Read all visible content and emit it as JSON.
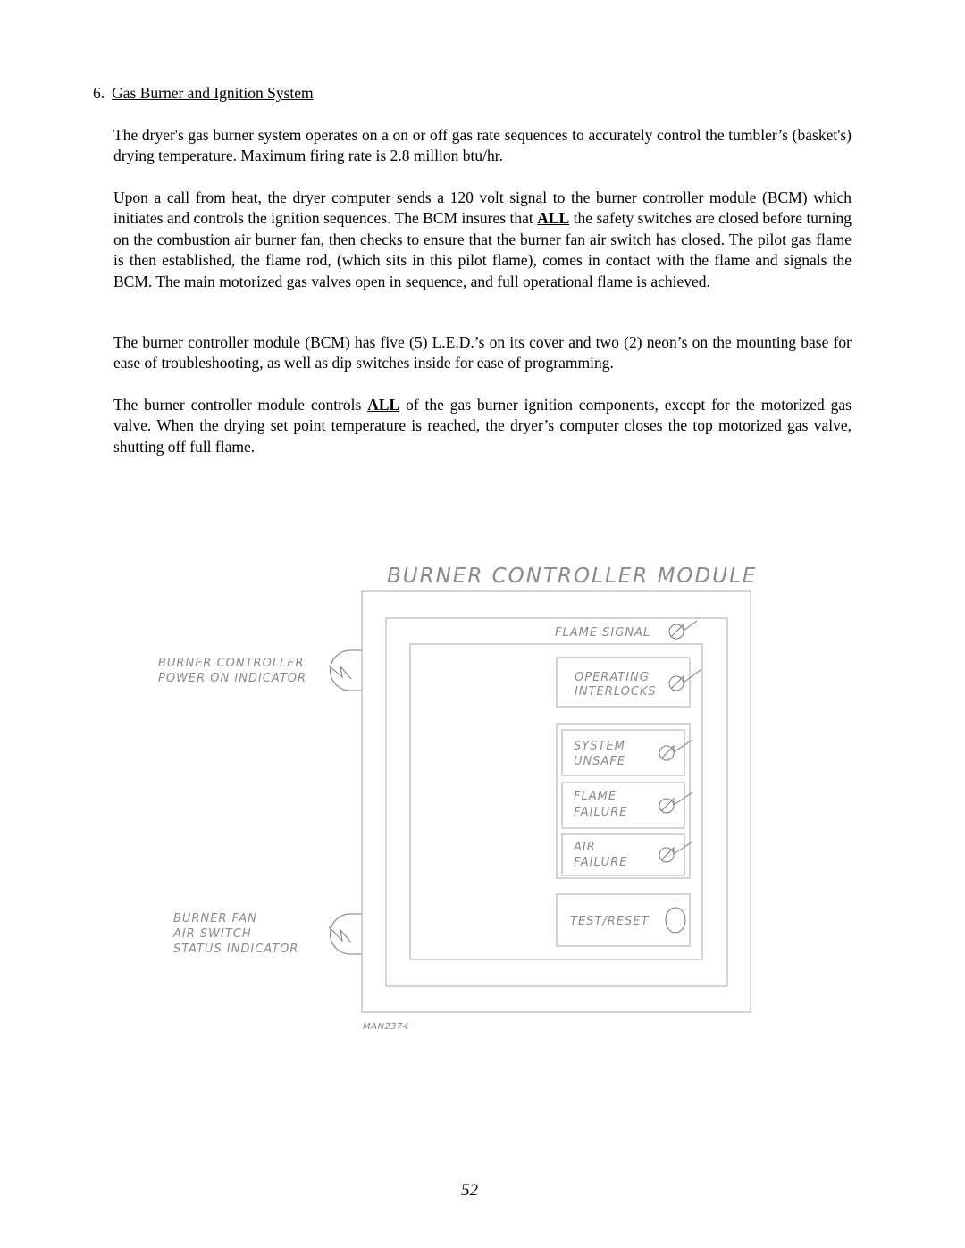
{
  "section": {
    "number": "6.",
    "title": "Gas Burner and Ignition System"
  },
  "paragraphs": {
    "p1": "The dryer's gas burner system operates on a on or off gas rate sequences to accurately control the tumbler’s (basket's) drying temperature.  Maximum firing rate is 2.8 million btu/hr.",
    "p2_before": "Upon a call from heat, the dryer computer sends a 120 volt signal to the burner controller module (BCM) which initiates and controls the ignition sequences.  The BCM insures that ",
    "p2_emph": "ALL",
    "p2_after": " the safety switches are closed before turning on the  combustion air  burner fan,  then  checks to ensure that the burner fan air switch has closed.  The pilot gas flame is then established, the flame rod, (which sits in this pilot flame), comes in contact with the flame and signals the BCM.  The main motorized gas valves open in sequence, and full operational flame is achieved.",
    "p3": "The burner controller module (BCM) has five (5) L.E.D.’s on its cover and two (2) neon’s on the mounting base for ease of troubleshooting, as well as dip switches inside for ease of programming.",
    "p4_before": "The  burner controller module controls ",
    "p4_emph": "ALL",
    "p4_after": " of  the gas burner ignition components, except for the motorized gas  valve.  When  the  drying  set  point temperature  is  reached,  the  dryer’s  computer closes the top motorized gas valve, shutting off full flame."
  },
  "diagram": {
    "title": "BURNER CONTROLLER MODULE",
    "flame_signal": "FLAME SIGNAL",
    "operating_interlocks": [
      "OPERATING",
      "INTERLOCKS"
    ],
    "system_unsafe": [
      "SYSTEM",
      "UNSAFE"
    ],
    "flame_failure": [
      "FLAME",
      "FAILURE"
    ],
    "air_failure": [
      "AIR",
      "FAILURE"
    ],
    "test_reset": "TEST/RESET",
    "power_indicator": [
      "BURNER CONTROLLER",
      "POWER ON INDICATOR"
    ],
    "air_switch_indicator": [
      "BURNER FAN",
      "AIR SWITCH",
      "STATUS INDICATOR"
    ],
    "drawing_id": "MAN2374",
    "icons": {
      "led": "led-indicator-icon",
      "neon": "neon-lamp-icon",
      "button": "test-reset-button-icon"
    }
  },
  "page_number": "52"
}
